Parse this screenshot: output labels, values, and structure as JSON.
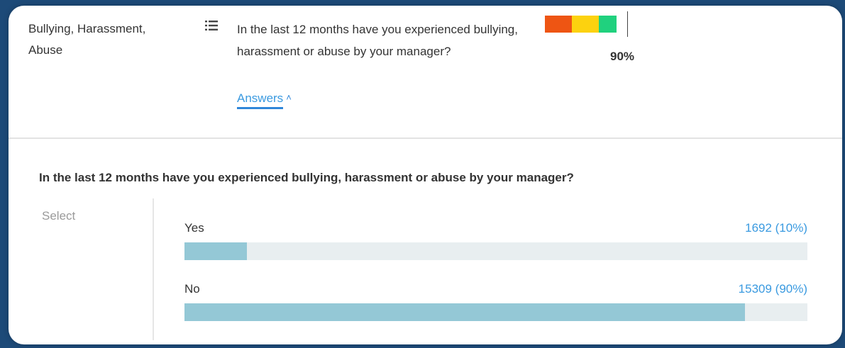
{
  "row": {
    "category": "Bullying, Harassment, Abuse",
    "question": "In the last 12 months have you experienced bullying, harassment or abuse by your manager?",
    "answers_link": "Answers",
    "score": "90%",
    "score_fraction": 0.9,
    "score_colors": [
      "#ee5513",
      "#fcd20f",
      "#20d17e"
    ]
  },
  "detail": {
    "title": "In the last 12 months have you experienced bullying, harassment or abuse by your manager?",
    "select_label": "Select",
    "answers": [
      {
        "label": "Yes",
        "count": "1692 (10%)",
        "fraction": 0.1
      },
      {
        "label": "No",
        "count": "15309 (90%)",
        "fraction": 0.9
      }
    ]
  },
  "icons": {
    "list": "list-icon",
    "chevron": "chevron-up-icon"
  },
  "colors": {
    "background": "#1d4a78",
    "link": "#3a9ae0",
    "bar_fill": "#94c8d6",
    "bar_track": "#e8eef0"
  }
}
